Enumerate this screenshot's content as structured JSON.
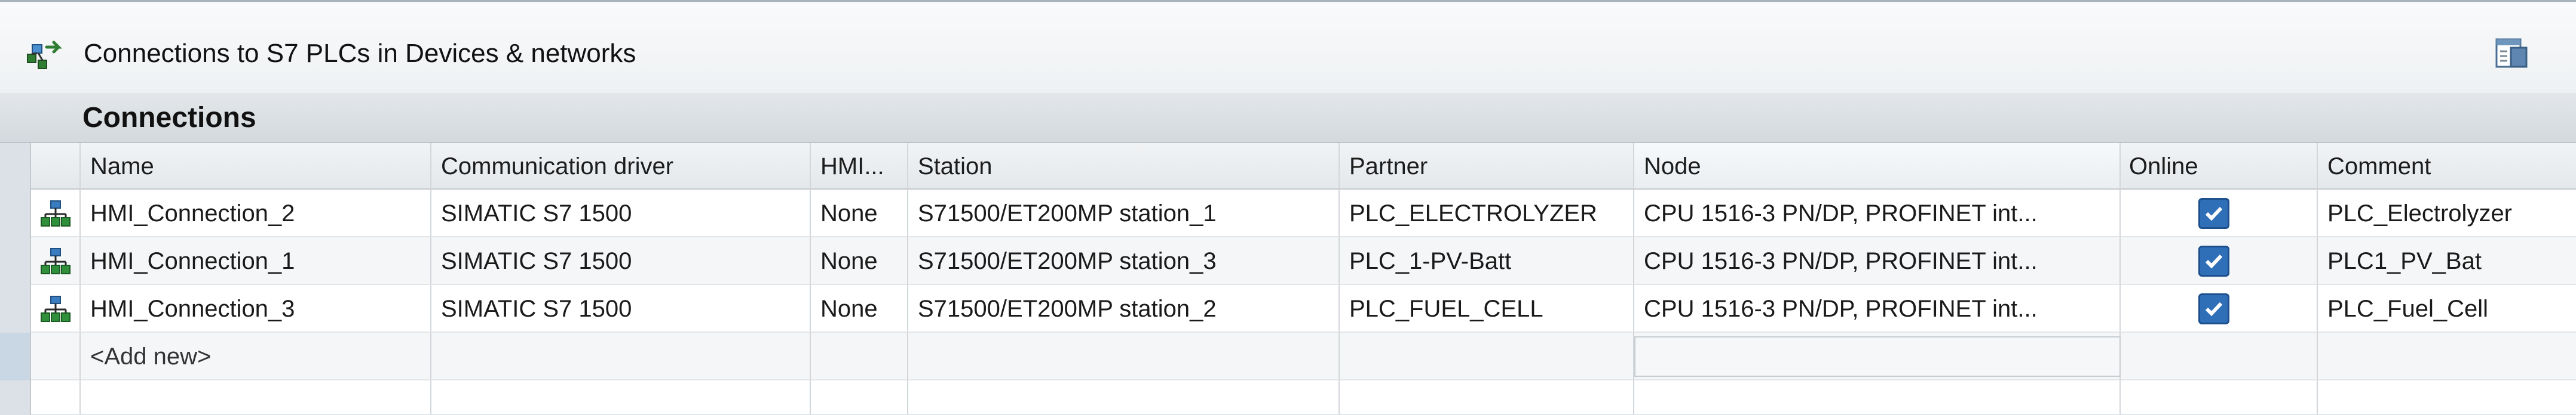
{
  "window": {
    "title": "Connections to S7 PLCs in Devices & networks",
    "title_icon": "plc-network-connect-icon",
    "panel_button_icon": "panel-layout-icon"
  },
  "section": {
    "title": "Connections"
  },
  "table": {
    "columns": [
      "Name",
      "Communication driver",
      "HMI...",
      "Station",
      "Partner",
      "Node",
      "Online",
      "Comment"
    ],
    "rows": [
      {
        "icon": "hmi-connection-icon",
        "name": "HMI_Connection_2",
        "driver": "SIMATIC S7 1500",
        "hmi": "None",
        "station": "S71500/ET200MP station_1",
        "partner": "PLC_ELECTROLYZER",
        "node": "CPU 1516-3 PN/DP, PROFINET int...",
        "online": true,
        "comment": "PLC_Electrolyzer"
      },
      {
        "icon": "hmi-connection-icon",
        "name": "HMI_Connection_1",
        "driver": "SIMATIC S7 1500",
        "hmi": "None",
        "station": "S71500/ET200MP station_3",
        "partner": "PLC_1-PV-Batt",
        "node": "CPU 1516-3 PN/DP, PROFINET int...",
        "online": true,
        "comment": "PLC1_PV_Bat"
      },
      {
        "icon": "hmi-connection-icon",
        "name": "HMI_Connection_3",
        "driver": "SIMATIC S7 1500",
        "hmi": "None",
        "station": "S71500/ET200MP station_2",
        "partner": "PLC_FUEL_CELL",
        "node": "CPU 1516-3 PN/DP, PROFINET int...",
        "online": true,
        "comment": "PLC_Fuel_Cell"
      }
    ],
    "add_new": "<Add new>"
  },
  "colors": {
    "checkbox": "#2e6fb8",
    "header_bg": "#e4e8eb",
    "section_bg": "#d4d9dd"
  }
}
